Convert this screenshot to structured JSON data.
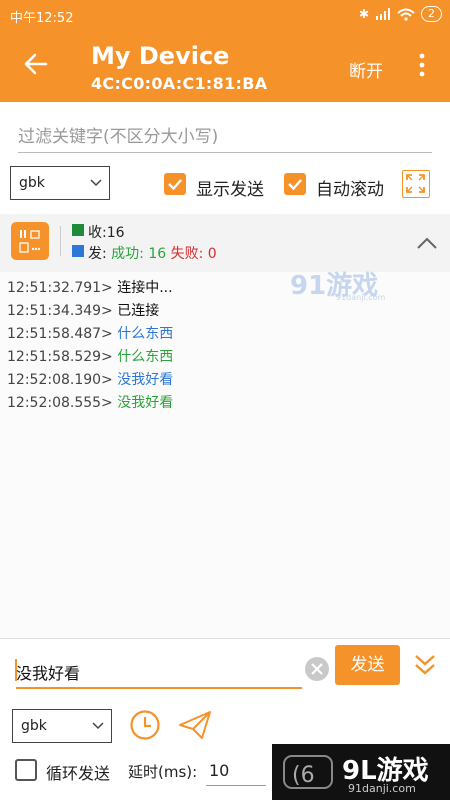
{
  "status_bar": {
    "time": "中午12:52",
    "battery": "2"
  },
  "app_bar": {
    "title": "My Device",
    "address": "4C:C0:0A:C1:81:BA",
    "disconnect_label": "断开"
  },
  "filter": {
    "placeholder": "过滤关键字(不区分大小写)"
  },
  "top_options": {
    "encoding": "gbk",
    "show_sent_label": "显示发送",
    "auto_scroll_label": "自动滚动"
  },
  "stats": {
    "received_label": "收:",
    "received_count": "16",
    "sent_label": "发:",
    "success_label": "成功:",
    "success_count": "16",
    "fail_label": "失败:",
    "fail_count": "0"
  },
  "log": [
    {
      "time": "12:51:32.791>",
      "text": "连接中...",
      "kind": "system"
    },
    {
      "time": "12:51:34.349>",
      "text": "已连接",
      "kind": "system"
    },
    {
      "time": "12:51:58.487>",
      "text": "什么东西",
      "kind": "sent"
    },
    {
      "time": "12:51:58.529>",
      "text": "什么东西",
      "kind": "received"
    },
    {
      "time": "12:52:08.190>",
      "text": "没我好看",
      "kind": "sent"
    },
    {
      "time": "12:52:08.555>",
      "text": "没我好看",
      "kind": "received"
    }
  ],
  "send_panel": {
    "input_value": "没我好看",
    "send_label": "发送",
    "encoding": "gbk",
    "loop_label": "循环发送",
    "delay_label": "延时(ms):",
    "delay_value": "10"
  },
  "watermarks": {
    "logo_top": "91游戏",
    "logo_top_url": "91danji.com",
    "logo_bottom": "9L游戏",
    "logo_bottom_url": "91danji.com"
  },
  "colors": {
    "accent": "#f5922a",
    "sent_text": "#2d78d6",
    "received_text": "#2aa43a",
    "fail_text": "#d62d2d",
    "received_square": "#1f8a3a",
    "sent_square": "#2d78d6"
  }
}
